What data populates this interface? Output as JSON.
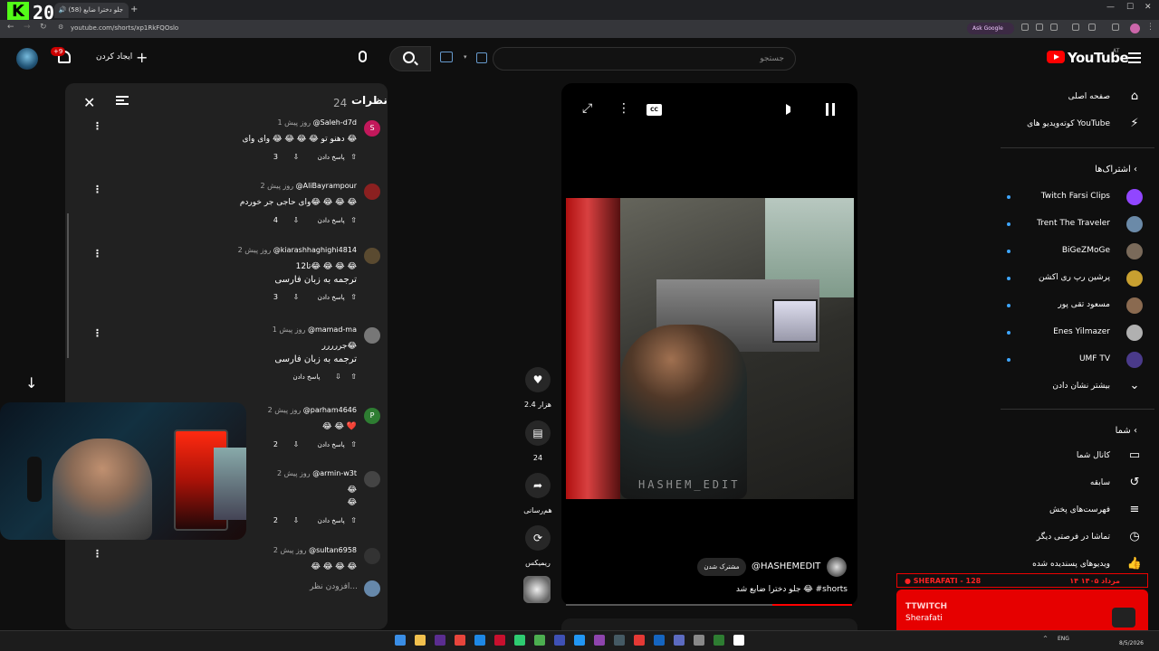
{
  "browser": {
    "tab_title": "جلو دخترا ضایع (58) 🔊",
    "url": "youtube.com/shorts/xp1RkFQOslo",
    "ask_google": "Ask Google",
    "stream_counter": "20"
  },
  "header": {
    "logo_text": "YouTube",
    "logo_sup": "AT",
    "search_placeholder": "جستجو",
    "create_label": "ایجاد کردن",
    "notifications_badge": "+9"
  },
  "comments_panel": {
    "title": "نظرات",
    "count": "24",
    "add_comment_placeholder": "افزودن نظر...",
    "comments": [
      {
        "author": "@Saleh-d7d",
        "time": "1 روز پیش",
        "avatar_letter": "S",
        "avatar_color": "#c2185b",
        "text": "دهنو تو 😂 😂 😂 😂 وای وای 😂",
        "likes": "3",
        "reply": "پاسخ دادن",
        "translate": ""
      },
      {
        "author": "@AliBayrampour",
        "time": "2 روز پیش",
        "avatar_letter": "",
        "avatar_color": "#8b2020",
        "text": "وای حاجی جر خوردم😂 😂 😂 😂",
        "likes": "4",
        "reply": "پاسخ دادن",
        "translate": ""
      },
      {
        "author": "@kiarashhaghighi4814",
        "time": "2 روز پیش",
        "avatar_letter": "",
        "avatar_color": "#5a4a30",
        "text": "12تا😂 😂 😂 😂",
        "likes": "3",
        "reply": "پاسخ دادن",
        "translate": "ترجمه به زبان فارسی"
      },
      {
        "author": "@mamad-ma",
        "time": "1 روز پیش",
        "avatar_letter": "",
        "avatar_color": "#777777",
        "text": "جررررر😂",
        "likes": "",
        "reply": "پاسخ دادن",
        "translate": "ترجمه به زبان فارسی"
      },
      {
        "author": "@parham4646",
        "time": "2 روز پیش",
        "avatar_letter": "P",
        "avatar_color": "#2e7d32",
        "text": "😂 😂 ❤️",
        "likes": "2",
        "reply": "پاسخ دادن",
        "translate": ""
      },
      {
        "author": "@armin-w3t",
        "time": "2 روز پیش",
        "avatar_letter": "",
        "avatar_color": "#444444",
        "text": "😂\n😂",
        "likes": "2",
        "reply": "پاسخ دادن",
        "translate": ""
      },
      {
        "author": "@sultan6958",
        "time": "2 روز پیش",
        "avatar_letter": "",
        "avatar_color": "#333333",
        "text": "😂 😂 😂 😂",
        "likes": "",
        "reply": "",
        "translate": ""
      }
    ]
  },
  "video": {
    "watermark": "HASHEM_EDIT",
    "cc_label": "CC",
    "channel": "@HASHEMEDIT",
    "subscribe": "مشترک شدن",
    "title": "جلو دخترا ضایع شد 😂 #shorts",
    "progress": 0.28,
    "likes": "2.4 هزار",
    "comments": "24",
    "share": "هم‌رسانی",
    "remix": "ریمیکس"
  },
  "sidebar": {
    "home": "صفحه اصلی",
    "shorts": "کوته‌ویدیو های YouTube",
    "subscriptions_title": "اشتراک‌ها",
    "subscriptions": [
      {
        "name": "Twitch Farsi Clips",
        "color": "#9146ff"
      },
      {
        "name": "Trent The Traveler",
        "color": "#6b8aa8"
      },
      {
        "name": "BiGeZMoGe",
        "color": "#7a6a5a"
      },
      {
        "name": "پرشین رپ ری اکشن",
        "color": "#c8a030"
      },
      {
        "name": "مسعود تقی پور",
        "color": "#8a6a50"
      },
      {
        "name": "Enes Yilmazer",
        "color": "#b0b0b0"
      },
      {
        "name": "UMF TV",
        "color": "#4a3a8a"
      }
    ],
    "show_more": "بیشتر نشان دادن",
    "you_title": "شما",
    "you_items": [
      "کانال شما",
      "سابقه",
      "فهرست‌های پخش",
      "تماشا در فرصتی دیگر",
      "ویدیوهای پسندیده شده"
    ]
  },
  "alert": {
    "header": "SHERAFATI - 128",
    "date": "۱۴ مرداد ۱۴۰۵",
    "line1": "TTWITCH",
    "line2": "Sherafati"
  },
  "taskbar": {
    "lang": "ENG",
    "date": "8/5/2026"
  }
}
